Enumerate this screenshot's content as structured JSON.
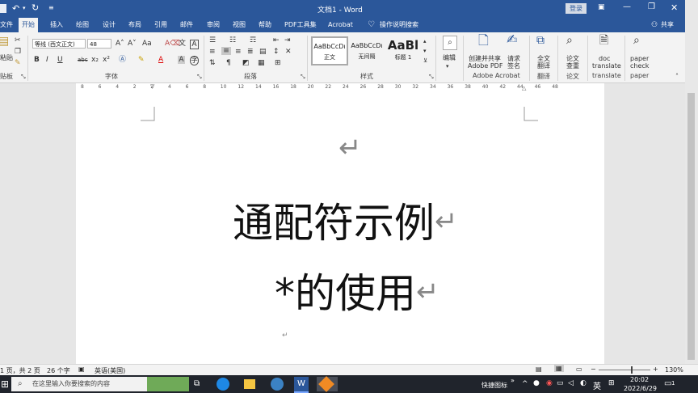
{
  "window": {
    "title": "文档1 - Word",
    "login": "登录",
    "share": "共享"
  },
  "tabs": [
    "文件",
    "开始",
    "插入",
    "绘图",
    "设计",
    "布局",
    "引用",
    "邮件",
    "审阅",
    "视图",
    "帮助",
    "PDF工具集",
    "Acrobat"
  ],
  "tell_me": "操作说明搜索",
  "ribbon": {
    "paste_label": "粘贴",
    "clipboard_group": "贴板",
    "font_name": "等线 (西文正文)",
    "font_size": "48",
    "font_group": "字体",
    "paragraph_group": "段落",
    "styles_group": "样式",
    "styles": [
      {
        "preview": "AaBbCcDı",
        "name": "正文"
      },
      {
        "preview": "AaBbCcDı",
        "name": "无间隔"
      },
      {
        "preview": "AaBl",
        "name": "标题 1"
      }
    ],
    "edit_label": "编辑",
    "acrobat_btn1_line1": "创建并共享",
    "acrobat_btn1_line2": "Adobe PDF",
    "acrobat_btn2_line1": "请求",
    "acrobat_btn2_line2": "签名",
    "acrobat_group": "Adobe Acrobat",
    "translate_line1": "全文",
    "translate_line2": "翻译",
    "translate_group": "翻译",
    "paper_line1": "论文",
    "paper_line2": "查重",
    "paper_group": "论文",
    "doc_translate_line1": "doc",
    "doc_translate_line2": "translate",
    "doc_translate_group": "translate",
    "paper_check_line1": "paper",
    "paper_check_line2": "check",
    "paper_check_group": "paper"
  },
  "ruler_numbers": [
    "8",
    "6",
    "4",
    "2",
    "2",
    "4",
    "6",
    "8",
    "10",
    "12",
    "14",
    "16",
    "18",
    "20",
    "22",
    "24",
    "26",
    "28",
    "30",
    "32",
    "34",
    "36",
    "38",
    "40",
    "42",
    "44",
    "46",
    "48"
  ],
  "document": {
    "line1": "通配符示例",
    "line2": "*的使用",
    "paragraph_mark": "↵"
  },
  "status": {
    "page": "1 页，共 2 页",
    "words": "26 个字",
    "language": "英语(美国)",
    "zoom": "130%"
  },
  "taskbar": {
    "search_placeholder": "在这里输入你要搜索的内容",
    "quick_icons": "快捷图标",
    "ime": "英",
    "time": "20:02",
    "date": "2022/6/29",
    "notifications": "1"
  }
}
